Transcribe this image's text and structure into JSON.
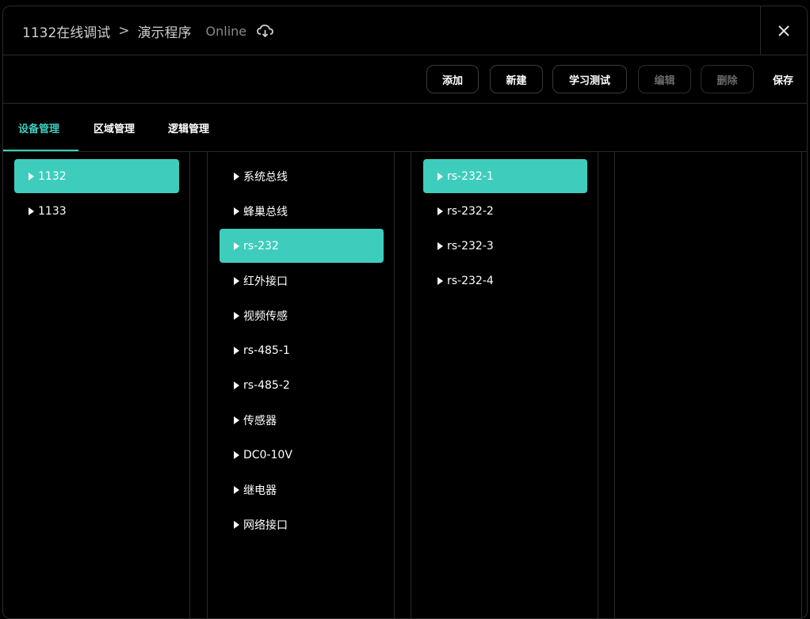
{
  "header": {
    "breadcrumb_root": "1132在线调试",
    "breadcrumb_separator": ">",
    "breadcrumb_current": "演示程序",
    "status": "Online",
    "cloud_icon": "cloud-sync-icon",
    "close_icon": "close-icon"
  },
  "toolbar": {
    "add": "添加",
    "new": "新建",
    "learn_test": "学习测试",
    "edit": "编辑",
    "delete": "删除",
    "save": "保存"
  },
  "tabs": [
    "设备管理",
    "区域管理",
    "逻辑管理"
  ],
  "active_tab": 0,
  "columns": {
    "devices": [
      "1132",
      "1133"
    ],
    "devices_selected": 0,
    "interfaces": [
      "系统总线",
      "蜂巢总线",
      "rs-232",
      "红外接口",
      "视频传感",
      "rs-485-1",
      "rs-485-2",
      "传感器",
      "DC0-10V",
      "继电器",
      "网络接口"
    ],
    "interfaces_selected": 2,
    "ports": [
      "rs-232-1",
      "rs-232-2",
      "rs-232-3",
      "rs-232-4"
    ],
    "ports_selected": 0
  },
  "colors": {
    "accent": "#3ecdbd",
    "background": "#000000",
    "border": "#2a2a2a"
  }
}
